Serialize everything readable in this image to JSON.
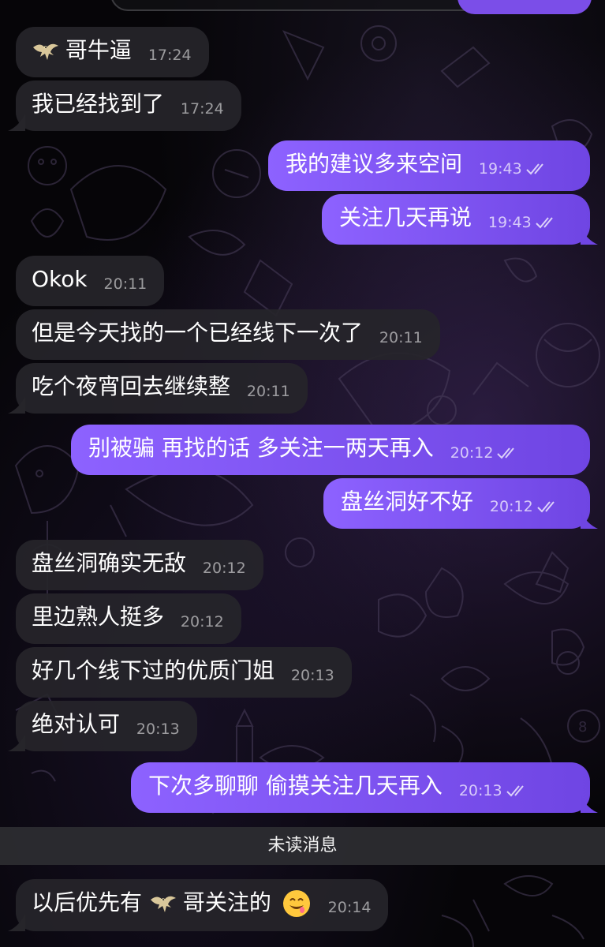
{
  "colors": {
    "outgoing_bubble": "#7b4ee8",
    "incoming_bubble": "#26252a",
    "unread_divider": "#2c2c30"
  },
  "messages": [
    {
      "dir": "in",
      "prefix_icon": "eagle-icon",
      "text": "哥牛逼",
      "time": "17:24"
    },
    {
      "dir": "in",
      "text": "我已经找到了",
      "time": "17:24"
    },
    {
      "dir": "out",
      "text": "我的建议多来空间",
      "time": "19:43",
      "status": "read-double-check-icon"
    },
    {
      "dir": "out",
      "text": "关注几天再说",
      "time": "19:43",
      "status": "read-double-check-icon"
    },
    {
      "dir": "in",
      "text": "Okok",
      "time": "20:11"
    },
    {
      "dir": "in",
      "text": "但是今天找的一个已经线下一次了",
      "time": "20:11"
    },
    {
      "dir": "in",
      "text": "吃个夜宵回去继续整",
      "time": "20:11"
    },
    {
      "dir": "out",
      "text": "别被骗 再找的话 多关注一两天再入",
      "time": "20:12",
      "status": "read-double-check-icon"
    },
    {
      "dir": "out",
      "text": "盘丝洞好不好",
      "time": "20:12",
      "status": "read-double-check-icon"
    },
    {
      "dir": "in",
      "text": "盘丝洞确实无敌",
      "time": "20:12"
    },
    {
      "dir": "in",
      "text": "里边熟人挺多",
      "time": "20:12"
    },
    {
      "dir": "in",
      "text": "好几个线下过的优质门姐",
      "time": "20:13"
    },
    {
      "dir": "in",
      "text": "绝对认可",
      "time": "20:13"
    },
    {
      "dir": "out",
      "text": "下次多聊聊 偷摸关注几天再入",
      "time": "20:13",
      "status": "read-double-check-icon"
    }
  ],
  "unread_divider": {
    "label": "未读消息"
  },
  "last_message": {
    "dir": "in",
    "text_before": "以后优先有",
    "inline_icon": "eagle-icon",
    "text_after": "哥关注的",
    "suffix_icon": "smiling-face-emoji-icon",
    "time": "20:14"
  }
}
